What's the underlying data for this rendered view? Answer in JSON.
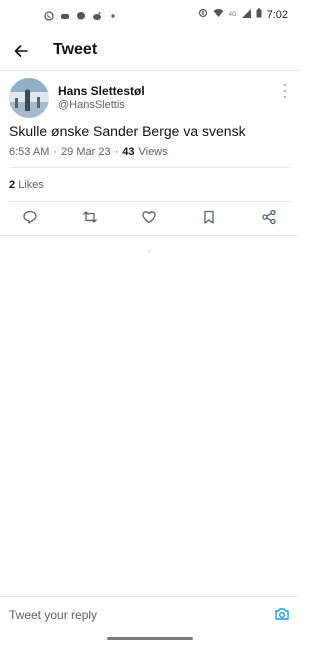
{
  "status_bar": {
    "time": "7:02",
    "network": "4G",
    "left_icons": [
      "whatsapp-icon",
      "gamepad-icon",
      "messenger-icon",
      "reddit-icon",
      "dot-icon"
    ],
    "right_icons": [
      "vibrate-icon",
      "wifi-icon",
      "signal-icon",
      "battery-icon"
    ]
  },
  "app_bar": {
    "title": "Tweet",
    "back_icon": "back-arrow-icon"
  },
  "tweet": {
    "author_name": "Hans Slettestøl",
    "author_handle": "@HansSlettis",
    "text": "Skulle ønske Sander Berge va svensk",
    "time": "6:53 AM",
    "separator1": "·",
    "date": "29 Mar 23",
    "separator2": "·",
    "views_count": "43",
    "views_label": "Views",
    "likes_count": "2",
    "likes_label": "Likes"
  },
  "actions": {
    "reply_icon": "reply-icon",
    "retweet_icon": "retweet-icon",
    "like_icon": "heart-icon",
    "bookmark_icon": "bookmark-icon",
    "share_icon": "share-icon"
  },
  "reply_bar": {
    "placeholder": "Tweet your reply",
    "camera_icon": "camera-icon"
  },
  "colors": {
    "accent": "#1d9bf0",
    "text_primary": "#0f1419",
    "text_secondary": "#536471",
    "divider": "#e7e7e7"
  }
}
